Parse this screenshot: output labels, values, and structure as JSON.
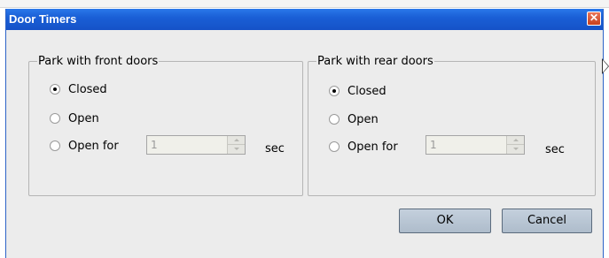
{
  "window": {
    "title": "Door Timers",
    "close_glyph": "✕"
  },
  "front_group": {
    "legend": "Park with front doors",
    "options": [
      {
        "label": "Closed",
        "checked": true
      },
      {
        "label": "Open",
        "checked": false
      },
      {
        "label": "Open for",
        "checked": false
      }
    ],
    "spinner_value": "1",
    "unit": "sec"
  },
  "rear_group": {
    "legend": "Park with rear doors",
    "options": [
      {
        "label": "Closed",
        "checked": true
      },
      {
        "label": "Open",
        "checked": false
      },
      {
        "label": "Open for",
        "checked": false
      }
    ],
    "spinner_value": "1",
    "unit": "sec"
  },
  "buttons": {
    "ok": "OK",
    "cancel": "Cancel"
  },
  "colors": {
    "titlebar": "#1a5fd6",
    "dialog_background": "#ececec",
    "button_face": "#aebccb"
  },
  "icons": {
    "close": "close-icon",
    "cursor": "mouse-pointer-icon"
  }
}
